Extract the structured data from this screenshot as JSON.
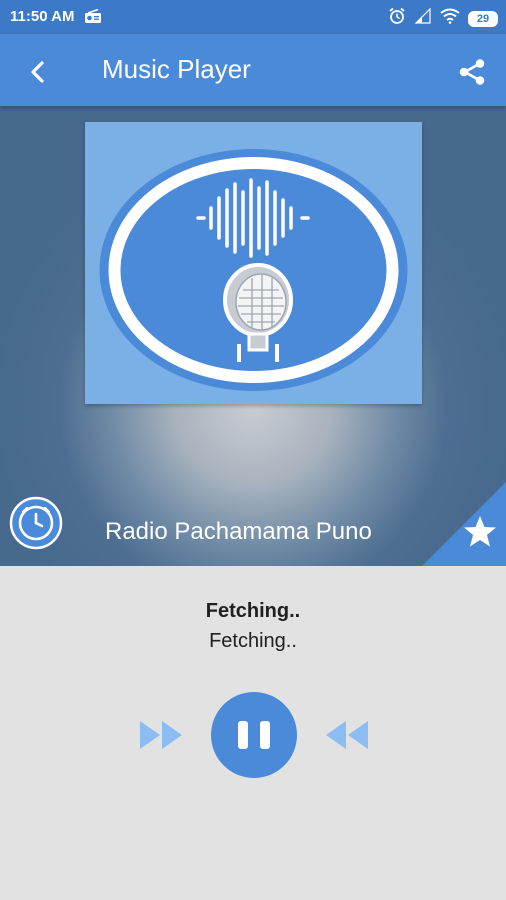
{
  "status_bar": {
    "time": "11:50 AM",
    "battery": "29",
    "icons": [
      "radio-icon",
      "alarm-icon",
      "signal-icon",
      "wifi-icon",
      "battery-icon"
    ]
  },
  "app_bar": {
    "title": "Music Player",
    "back_icon": "back-arrow-icon",
    "share_icon": "share-icon"
  },
  "station": {
    "name": "Radio Pachamama Puno",
    "artwork_icon": "microphone-soundwave-icon"
  },
  "now_playing": {
    "title": "Fetching..",
    "subtitle": "Fetching.."
  },
  "controls": {
    "left_icon": "fast-forward-icon",
    "center_icon": "pause-icon",
    "right_icon": "rewind-icon"
  },
  "colors": {
    "primary": "#4a8ad8",
    "status_bar": "#3c79c6",
    "control_light": "#8bbcf2",
    "panel": "#e2e2e2"
  }
}
